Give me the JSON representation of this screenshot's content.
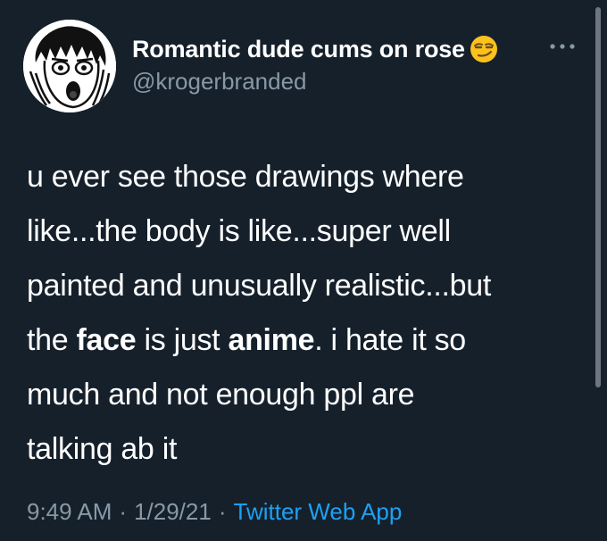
{
  "tweet": {
    "display_name": "Romantic dude cums on rose",
    "handle": "@krogerbranded",
    "name_emoji": "smirking-face-icon",
    "body": {
      "line1": "u ever see those drawings where",
      "line2": "like...the body is like...super well",
      "line3": "painted and unusually realistic...but",
      "line4_pre": "the ",
      "line4_bold1": "face",
      "line4_mid": " is just ",
      "line4_bold2": "anime",
      "line4_post": ". i hate it so",
      "line5": "much and not enough ppl are",
      "line6": "talking ab it"
    },
    "time": "9:49 AM",
    "separator": "·",
    "date": "1/29/21",
    "source": "Twitter Web App"
  },
  "colors": {
    "background": "#15202b",
    "text_primary": "#ffffff",
    "text_secondary": "#8899a6",
    "link": "#1da1f2"
  }
}
